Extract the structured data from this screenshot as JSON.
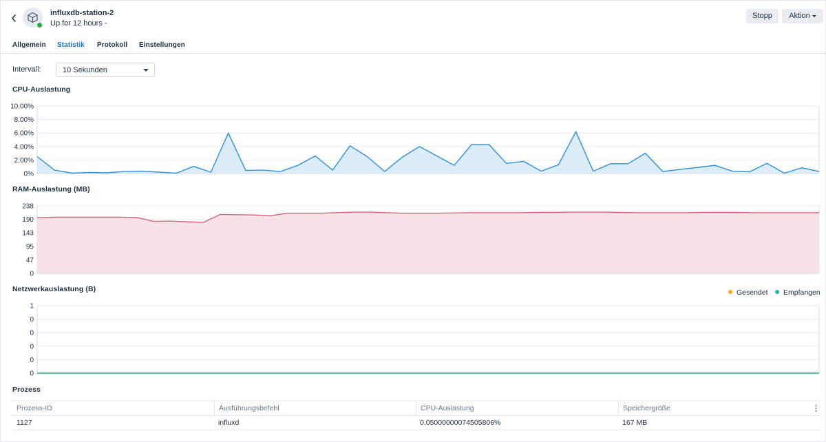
{
  "header": {
    "title": "influxdb-station-2",
    "subtitle": "Up for 12 hours -",
    "stop_label": "Stopp",
    "action_label": "Aktion",
    "status_color": "#1aaf3c",
    "icons": [
      "chevron-left-icon",
      "cube-icon",
      "caret-down-icon"
    ]
  },
  "tabs": [
    {
      "label": "Allgemein",
      "active": false
    },
    {
      "label": "Statistik",
      "active": true
    },
    {
      "label": "Protokoll",
      "active": false
    },
    {
      "label": "Einstellungen",
      "active": false
    }
  ],
  "interval": {
    "label": "Intervall:",
    "value": "10 Sekunden"
  },
  "colors": {
    "cpu_line": "#2b8fe0",
    "cpu_fill": "#d7e9f8",
    "ram_line": "#de5c7c",
    "ram_fill": "#f6dde4",
    "net_sent": "#f5a623",
    "net_received": "#26b8a6",
    "accent": "#1a73c8"
  },
  "charts": {
    "cpu_title": "CPU-Auslastung",
    "ram_title": "RAM-Auslastung (MB)",
    "net_title": "Netzwerkauslastung (B)",
    "legend_sent": "Gesendet",
    "legend_received": "Empfangen"
  },
  "chart_data": [
    {
      "type": "area",
      "title": "CPU-Auslastung",
      "ylim": [
        0,
        10
      ],
      "yticks": [
        "0%",
        "2.00%",
        "4.00%",
        "6.00%",
        "8.00%",
        "10.00%"
      ],
      "grid": true,
      "x": [
        0,
        1,
        2,
        3,
        4,
        5,
        6,
        7,
        8,
        9,
        10,
        11,
        12,
        13,
        14,
        15,
        16,
        17,
        18,
        19,
        20,
        21,
        22,
        23,
        24,
        25,
        26,
        27,
        28,
        29,
        30,
        31,
        32,
        33,
        34,
        35,
        36,
        37,
        38,
        39,
        40,
        41,
        42,
        43,
        44,
        45,
        46,
        47,
        48
      ],
      "values": [
        2.5,
        0.5,
        0.05,
        0.15,
        0.1,
        0.3,
        0.35,
        0.2,
        0.05,
        1.05,
        0.2,
        6.0,
        0.45,
        0.5,
        0.3,
        1.2,
        2.6,
        0.5,
        4.1,
        2.5,
        0.3,
        2.4,
        4.0,
        2.6,
        1.2,
        4.3,
        4.3,
        1.5,
        1.8,
        0.35,
        1.3,
        6.2,
        0.35,
        1.45,
        1.45,
        3.0,
        0.3,
        0.6,
        0.9,
        1.2,
        0.35,
        0.25,
        1.5,
        0.05,
        0.85,
        0.3
      ]
    },
    {
      "type": "area",
      "title": "RAM-Auslastung (MB)",
      "ylim": [
        0,
        238
      ],
      "yticks": [
        "0",
        "47",
        "95",
        "143",
        "190",
        "238"
      ],
      "grid": true,
      "values": [
        196,
        198,
        198,
        198,
        198,
        198,
        197,
        183,
        184,
        182,
        180,
        208,
        207,
        206,
        203,
        212,
        212,
        212,
        214,
        216,
        216,
        214,
        212,
        212,
        212,
        213,
        214,
        214,
        214,
        214,
        215,
        215,
        216,
        216,
        216,
        215,
        214,
        214,
        214,
        214,
        215,
        215,
        215,
        214,
        214,
        214,
        214,
        214
      ]
    },
    {
      "type": "line",
      "title": "Netzwerkauslastung (B)",
      "ylim": [
        0,
        1
      ],
      "yticks": [
        "0",
        "0",
        "0",
        "0",
        "0",
        "1"
      ],
      "grid": true,
      "legend": "top-right",
      "series": [
        {
          "name": "Gesendet",
          "constant": 0
        },
        {
          "name": "Empfangen",
          "constant": 0
        }
      ]
    }
  ],
  "process": {
    "title": "Prozess",
    "columns": [
      "Prozess-ID",
      "Ausführungsbefehl",
      "CPU-Auslastung",
      "Speichergröße"
    ],
    "rows": [
      [
        "1127",
        "influxd",
        "0.05000000074505806%",
        "167 MB"
      ]
    ]
  }
}
